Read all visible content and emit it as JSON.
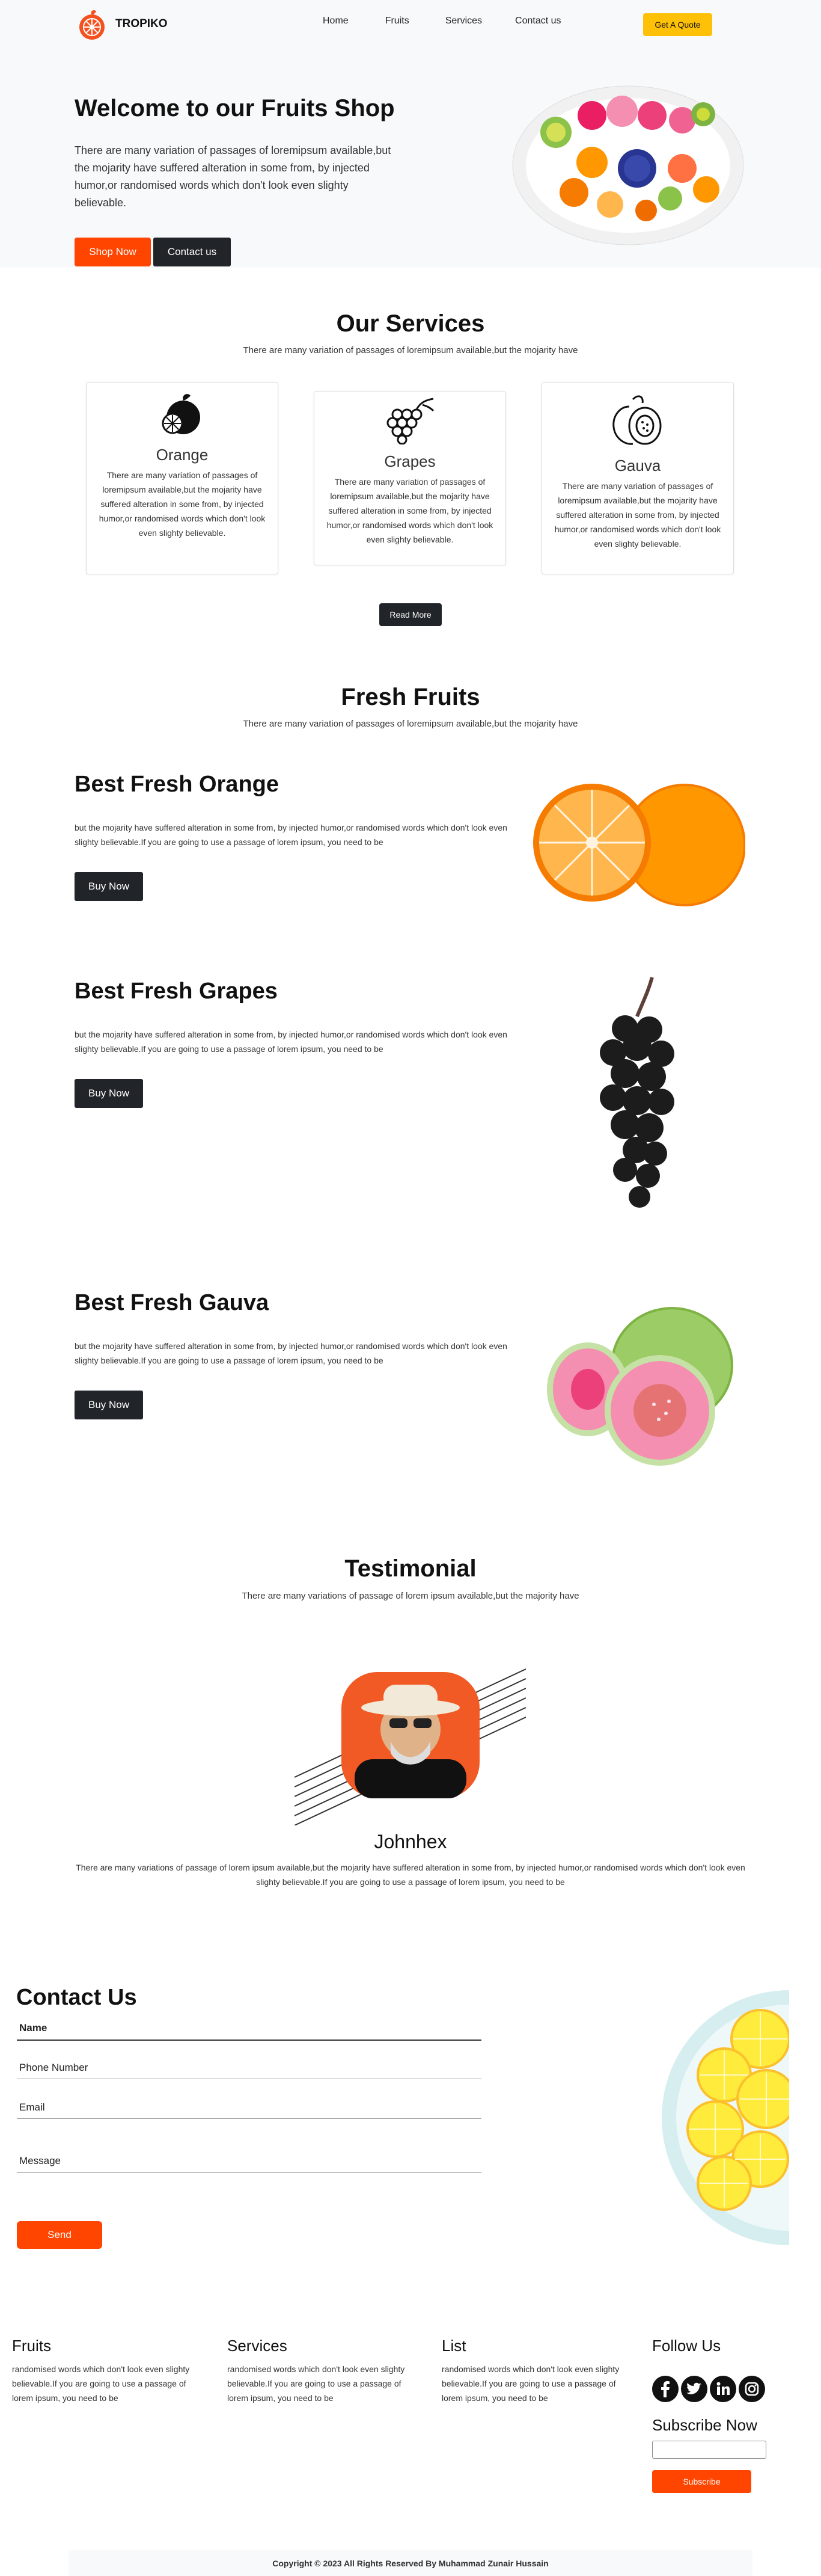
{
  "brand": {
    "name": "TROPIKO"
  },
  "nav": {
    "links": [
      "Home",
      "Fruits",
      "Services",
      "Contact us"
    ],
    "quote_label": "Get A Quote"
  },
  "hero": {
    "title": "Welcome to our Fruits Shop",
    "text": "There are many variation of passages of loremipsum available,but the mojarity have suffered alteration in some from, by injected humor,or randomised words which don't look even slighty believable.",
    "shop_label": "Shop Now",
    "contact_label": "Contact us"
  },
  "services": {
    "title": "Our Services",
    "subtitle": "There are many variation of passages of loremipsum available,but the mojarity have",
    "cards": [
      {
        "icon": "orange-icon",
        "title": "Orange",
        "text": "There are many variation of passages of loremipsum available,but the mojarity have suffered alteration in some from, by injected humor,or randomised words which don't look even slighty believable."
      },
      {
        "icon": "grapes-icon",
        "title": "Grapes",
        "text": "There are many variation of passages of loremipsum available,but the mojarity have suffered alteration in some from, by injected humor,or randomised words which don't look even slighty believable."
      },
      {
        "icon": "guava-icon",
        "title": "Gauva",
        "text": "There are many variation of passages of loremipsum available,but the mojarity have suffered alteration in some from, by injected humor,or randomised words which don't look even slighty believable."
      }
    ],
    "read_more_label": "Read More"
  },
  "fresh": {
    "title": "Fresh Fruits",
    "subtitle": "There are many variation of passages of loremipsum available,but the mojarity have",
    "items": [
      {
        "title": "Best Fresh Orange",
        "text": "but the mojarity have suffered alteration in some from, by injected humor,or randomised words which don't look even slighty believable.If you are going to use a passage of lorem ipsum, you need to be",
        "button": "Buy Now"
      },
      {
        "title": "Best Fresh Grapes",
        "text": "but the mojarity have suffered alteration in some from, by injected humor,or randomised words which don't look even slighty believable.If you are going to use a passage of lorem ipsum, you need to be",
        "button": "Buy Now"
      },
      {
        "title": "Best Fresh Gauva",
        "text": "but the mojarity have suffered alteration in some from, by injected humor,or randomised words which don't look even slighty believable.If you are going to use a passage of lorem ipsum, you need to be",
        "button": "Buy Now"
      }
    ]
  },
  "testimonial": {
    "title": "Testimonial",
    "subtitle": "There are many variations of passage of lorem ipsum available,but the majority have",
    "name": "Johnhex",
    "text": "There are many variations of passage of lorem ipsum available,but the mojarity have suffered alteration in some from, by injected humor,or randomised words which don't look even slighty believable.If you are going to use a passage of lorem ipsum, you need to be"
  },
  "contact": {
    "title": "Contact Us",
    "fields": {
      "name": "Name",
      "phone": "Phone Number",
      "email": "Email",
      "message": "Message"
    },
    "send_label": "Send"
  },
  "footer": {
    "fruits": {
      "title": "Fruits",
      "text": "randomised words which don't look even slighty believable.If you are going to use a passage of lorem ipsum, you need to be"
    },
    "services": {
      "title": "Services",
      "text": "randomised words which don't look even slighty believable.If you are going to use a passage of lorem ipsum, you need to be"
    },
    "list": {
      "title": "List",
      "text": "randomised words which don't look even slighty believable.If you are going to use a passage of lorem ipsum, you need to be"
    },
    "follow": {
      "title": "Follow Us",
      "icons": [
        "facebook-icon",
        "twitter-icon",
        "linkedin-icon",
        "instagram-icon"
      ]
    },
    "subscribe": {
      "title": "Subscribe Now",
      "button": "Subscribe"
    },
    "copyright": "Copyright © 2023 All Rights Reserved By Muhammad Zunair Hussain"
  },
  "colors": {
    "accent": "#ff4500",
    "yellow": "#ffc107",
    "dark": "#212529",
    "light_bg": "#f8f9fa"
  }
}
